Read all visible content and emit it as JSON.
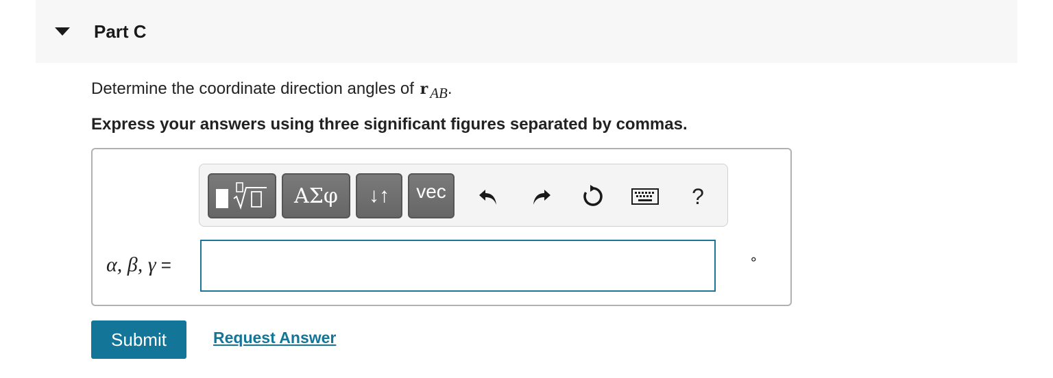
{
  "part": {
    "title": "Part C"
  },
  "question": {
    "prefix": "Determine the coordinate direction angles of",
    "vector_symbol": "r",
    "vector_subscript": "AB",
    "suffix": "."
  },
  "instruction": "Express your answers using three significant figures separated by commas.",
  "toolbar": {
    "buttons": [
      {
        "name": "templates",
        "icon": "square-root-template-icon"
      },
      {
        "name": "greek",
        "label": "ΑΣφ"
      },
      {
        "name": "arrows",
        "label": "↓↑"
      },
      {
        "name": "vec",
        "label": "vec"
      }
    ],
    "icons": [
      "undo-icon",
      "redo-icon",
      "reset-icon",
      "keyboard-icon"
    ],
    "help_label": "?"
  },
  "answer": {
    "variable_label": "α, β, γ",
    "equals": "=",
    "value": "",
    "unit": "∘"
  },
  "actions": {
    "submit_label": "Submit",
    "request_label": "Request Answer"
  },
  "colors": {
    "accent": "#137598",
    "toolbar_button": "#6e6e6e",
    "header_bg": "#f7f7f7"
  }
}
